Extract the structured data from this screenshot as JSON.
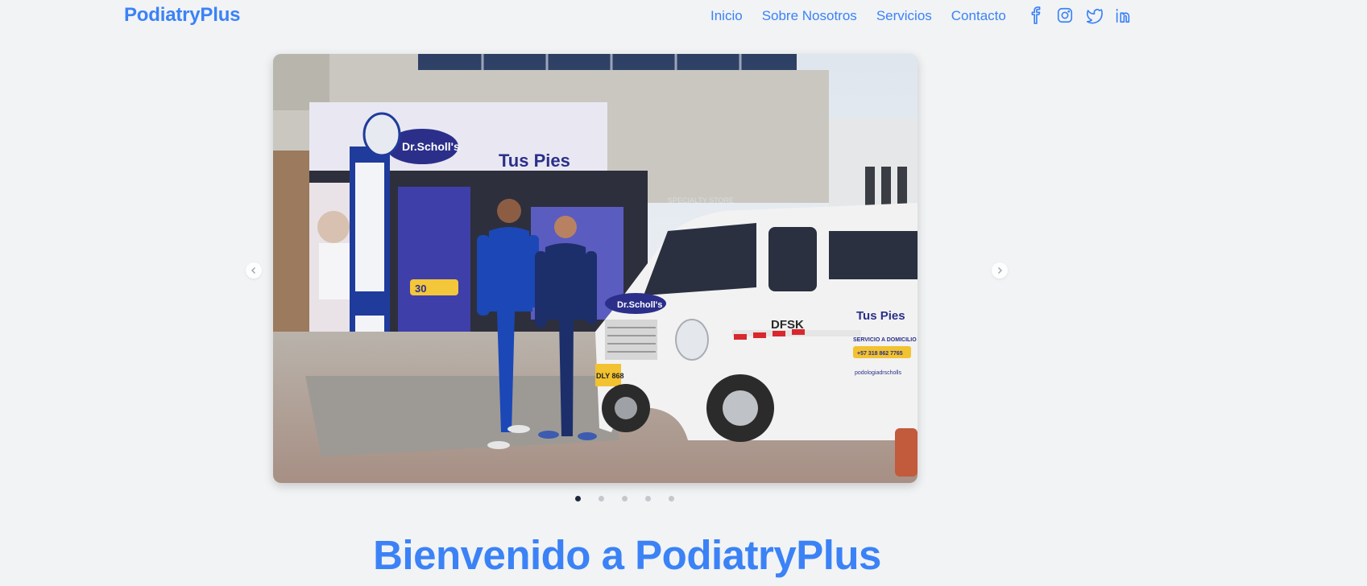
{
  "header": {
    "brand": "PodiatryPlus",
    "nav": [
      "Inicio",
      "Sobre Nosotros",
      "Servicios",
      "Contacto"
    ],
    "social_icons": [
      "facebook-icon",
      "instagram-icon",
      "twitter-icon",
      "linkedin-icon"
    ]
  },
  "carousel": {
    "slide_count": 5,
    "active_index": 0,
    "prev_icon": "chevron-left-icon",
    "next_icon": "chevron-right-icon",
    "photo_texts": {
      "store_sign": "Tus Pies",
      "brand_sign": "Dr.Scholl's",
      "specialty": "SPECIALTY STORE",
      "van_logo": "DFSK",
      "van_service": "SERVICIO A DOMICILIO",
      "van_phone": "+57 318 862 7765",
      "van_handle": "podologiadrscholls",
      "plate": "DLY 868",
      "promo": "30"
    }
  },
  "hero": {
    "title": "Bienvenido a PodiatryPlus"
  },
  "colors": {
    "accent": "#3b82f6",
    "background": "#f1f3f5"
  }
}
